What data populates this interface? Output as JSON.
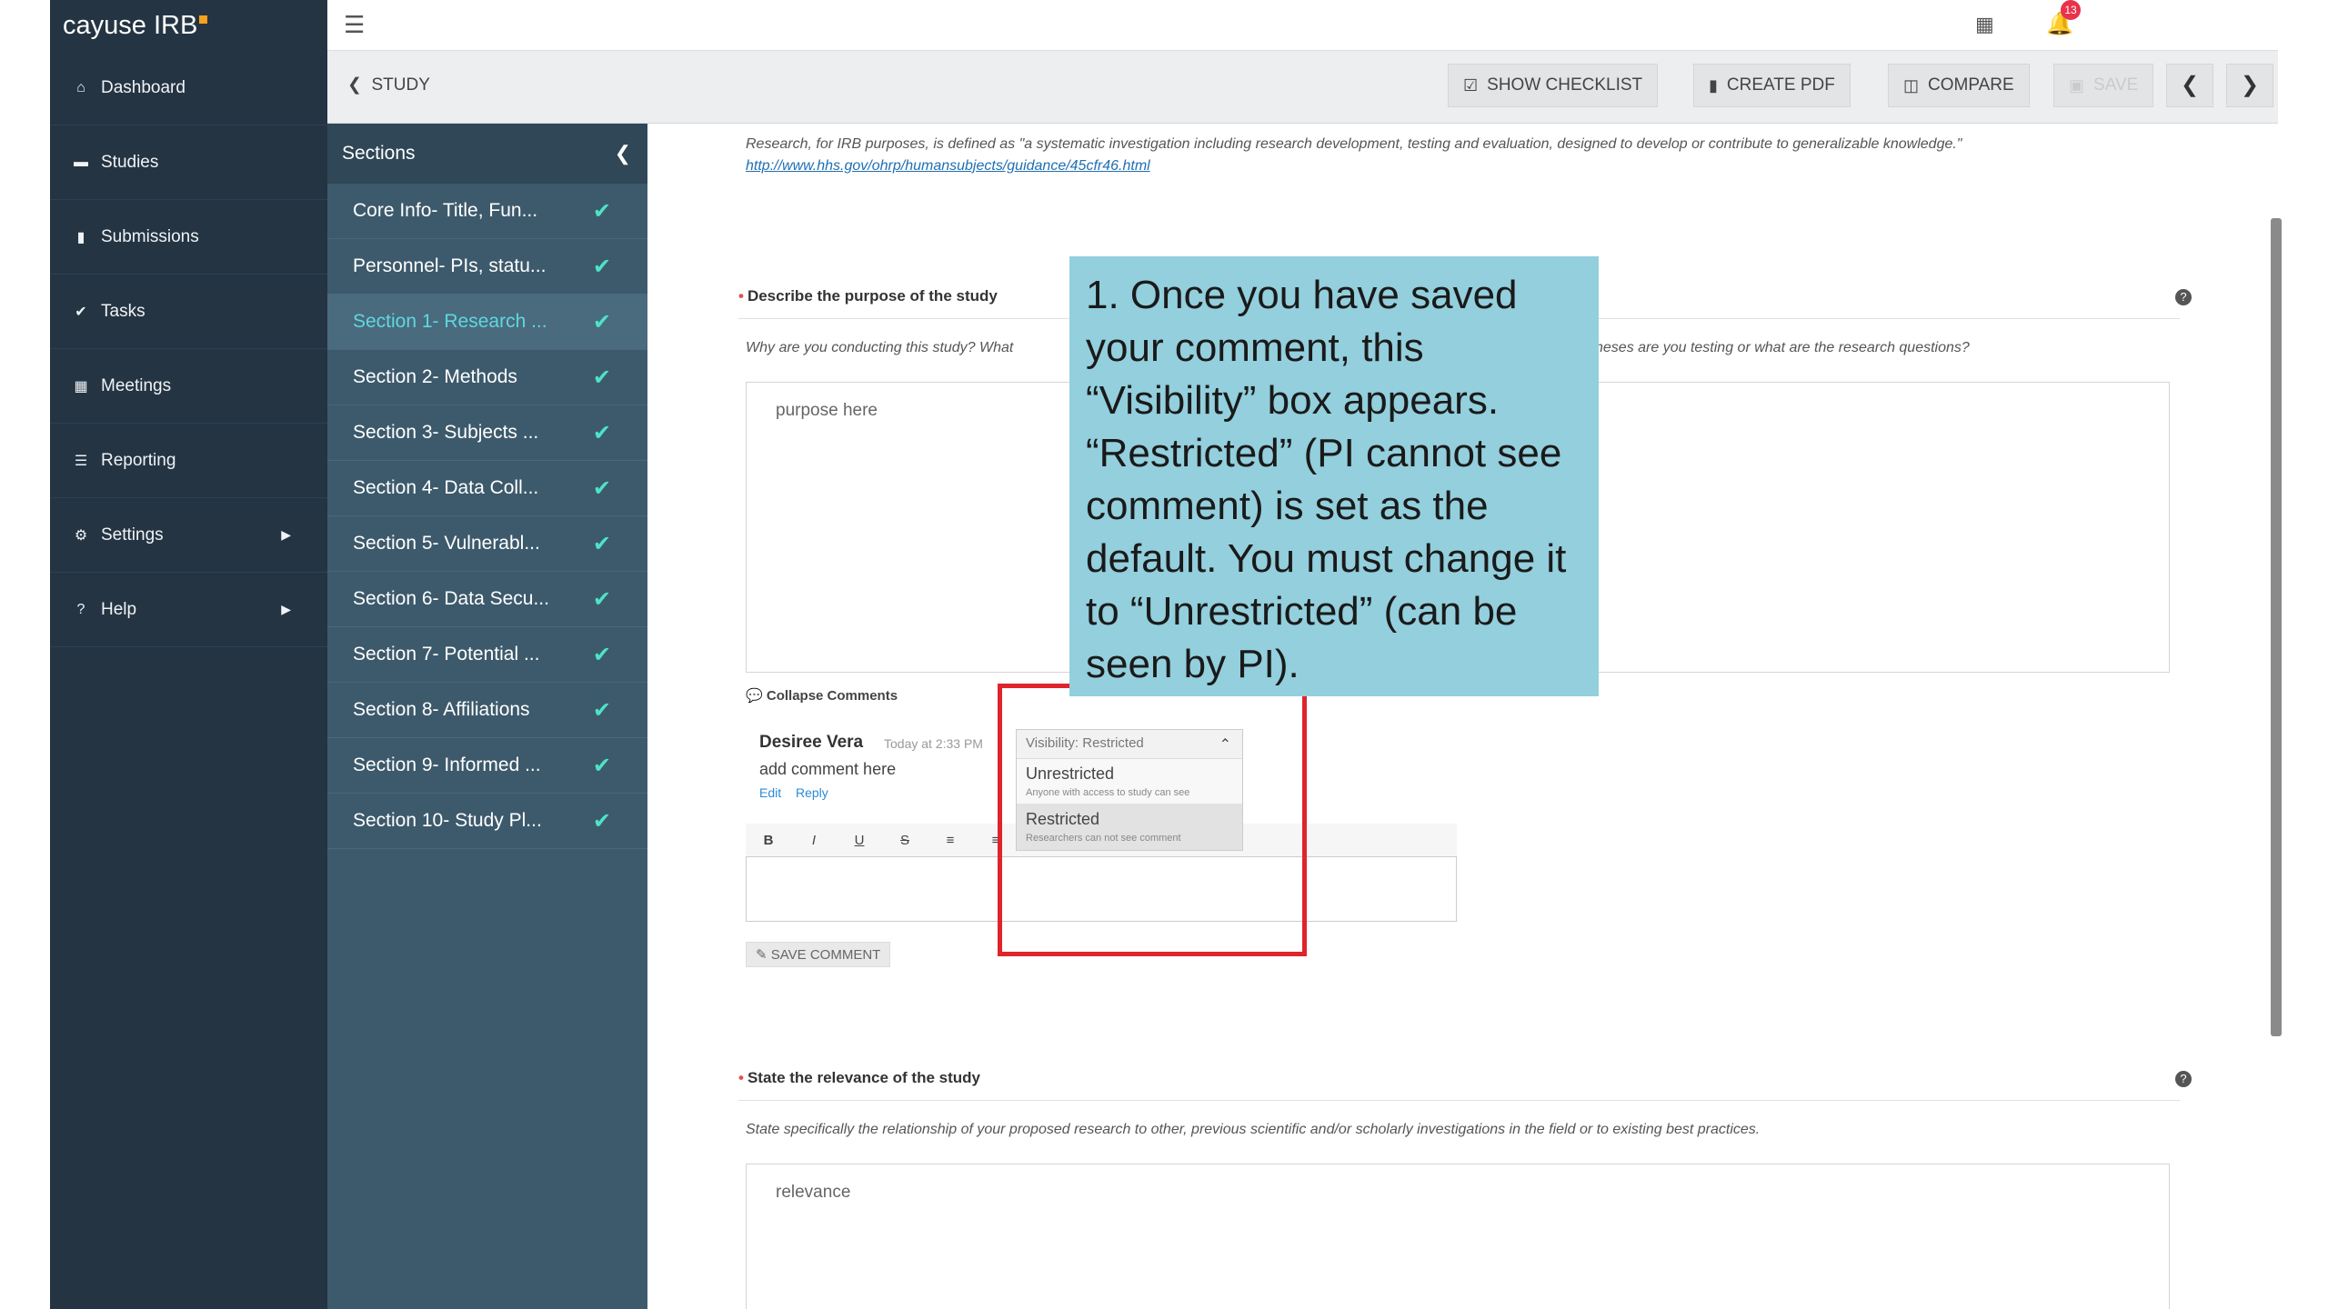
{
  "app": {
    "name": "cayuse IRB"
  },
  "nav": {
    "items": [
      {
        "label": "Dashboard",
        "icon": "home-icon"
      },
      {
        "label": "Studies",
        "icon": "folder-icon"
      },
      {
        "label": "Submissions",
        "icon": "document-icon"
      },
      {
        "label": "Tasks",
        "icon": "check-icon"
      },
      {
        "label": "Meetings",
        "icon": "calendar-icon"
      },
      {
        "label": "Reporting",
        "icon": "list-icon"
      },
      {
        "label": "Settings",
        "icon": "gear-icon"
      },
      {
        "label": "Help",
        "icon": "question-icon"
      }
    ]
  },
  "topbar": {
    "notification_count": "13"
  },
  "studybar": {
    "back_label": "STUDY",
    "show_checklist": "SHOW CHECKLIST",
    "create_pdf": "CREATE PDF",
    "compare": "COMPARE",
    "save": "SAVE"
  },
  "sections": {
    "title": "Sections",
    "items": [
      {
        "label": "Core Info- Title, Fun..."
      },
      {
        "label": "Personnel- PIs, statu..."
      },
      {
        "label": "Section 1- Research ..."
      },
      {
        "label": "Section 2- Methods"
      },
      {
        "label": "Section 3- Subjects ..."
      },
      {
        "label": "Section 4- Data Coll..."
      },
      {
        "label": "Section 5- Vulnerabl..."
      },
      {
        "label": "Section 6- Data Secu..."
      },
      {
        "label": "Section 7- Potential ..."
      },
      {
        "label": "Section 8- Affiliations"
      },
      {
        "label": "Section 9- Informed ..."
      },
      {
        "label": "Section 10- Study Pl..."
      }
    ]
  },
  "main": {
    "research_note": "Research, for IRB purposes, is defined as \"a systematic investigation including research development, testing and evaluation, designed to develop or contribute to generalizable knowledge.\"",
    "research_link": "http://www.hhs.gov/ohrp/humansubjects/guidance/45cfr46.html",
    "q1": {
      "label": "Describe the purpose of the study",
      "hint_left": "Why are you conducting this study? What",
      "hint_right": "heses are you testing or what are the research questions?",
      "answer": "purpose here"
    },
    "comments": {
      "collapse_label": "Collapse Comments",
      "author": "Desiree Vera",
      "time": "Today at 2:33 PM",
      "text": "add comment here",
      "edit": "Edit",
      "reply": "Reply",
      "save_comment": "SAVE COMMENT",
      "toolbar": [
        "B",
        "I",
        "U",
        "S",
        "≡",
        "≡"
      ]
    },
    "visibility": {
      "header": "Visibility: Restricted",
      "options": [
        {
          "title": "Unrestricted",
          "desc": "Anyone with access to study can see"
        },
        {
          "title": "Restricted",
          "desc": "Researchers can not see comment"
        }
      ]
    },
    "q2": {
      "label": "State the relevance of the study",
      "hint": "State specifically the relationship of your proposed research to other, previous scientific and/or scholarly investigations in the field or to existing best practices.",
      "answer": "relevance"
    }
  },
  "callout": {
    "text": "1. Once you have saved your comment, this “Visibility” box appears. “Restricted” (PI cannot see comment) is set as the default. You must change it to “Unrestricted” (can be seen by PI)."
  }
}
